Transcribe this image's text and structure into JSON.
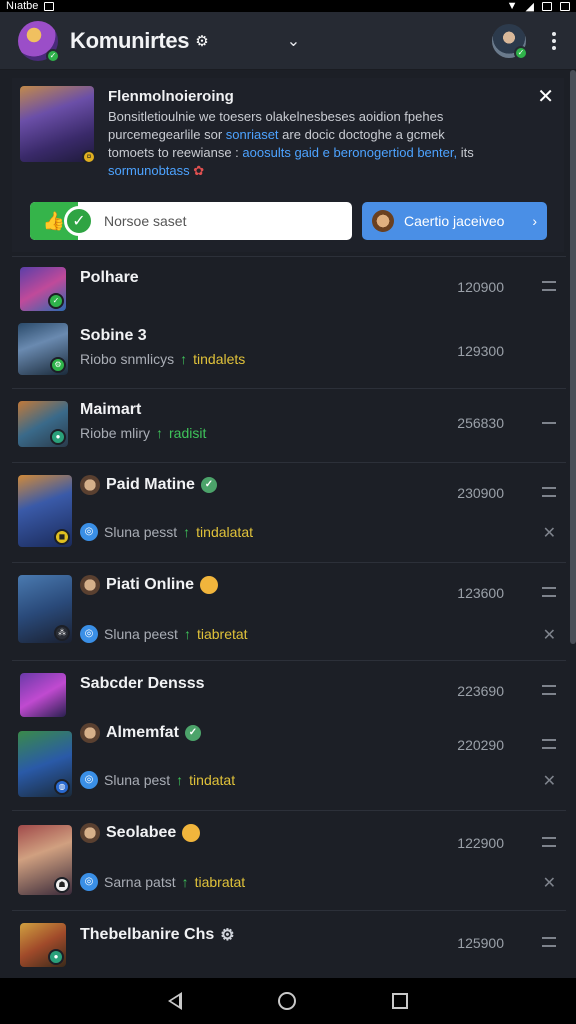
{
  "status_bar": {
    "carrier": "Nıatbe"
  },
  "header": {
    "title": "Komunirtes",
    "title_icon": "settings-icon",
    "user_avatar": "user-avatar"
  },
  "banner": {
    "title": "Flenmolnoieroing",
    "text_1": "Bonsitletioulnie we toesers olakelnesbeses aoidion fpehes",
    "text_2": "purcemegearlile sor",
    "text_2_link": "sonriaset",
    "text_3": "are docic doctoghe a gcmek",
    "text_4": "tomoets to reewianse :",
    "text_4_link": "aoosults gaid e beronogertiod benter,",
    "text_4_end": "its",
    "text_5_link": "sormunobtass",
    "vote_label": "Norsoe saset",
    "cta_label": "Caertio jaceiveo",
    "colors": {
      "vote": "#35b44a",
      "cta": "#4a8fe6"
    }
  },
  "list": [
    {
      "title": "Polhare",
      "subtitle": "",
      "tag": "",
      "count": "120900"
    },
    {
      "title": "Sobine 3",
      "subtitle": "Riobo snmlicys",
      "tag": "tindalets",
      "count": "129300"
    },
    {
      "title": "Maimart",
      "subtitle": "Riobe mliry",
      "tag": "radisit",
      "count": "256830"
    },
    {
      "title": "Paid Matine",
      "subtitle": "Sluna pesst",
      "tag": "tindalatat",
      "count": "230900"
    },
    {
      "title": "Piati Online",
      "subtitle": "Sluna peest",
      "tag": "tiabretat",
      "count": "123600"
    },
    {
      "title": "Sabcder Densss",
      "subtitle": "",
      "tag": "",
      "count": "223690"
    },
    {
      "title": "Almemfat",
      "subtitle": "Sluna pest",
      "tag": "tindatat",
      "count": "220290"
    },
    {
      "title": "Seolabee",
      "subtitle": "Sarna patst",
      "tag": "tiabratat",
      "count": "122900"
    },
    {
      "title": "Thebelbanire Chs",
      "subtitle": "",
      "tag": "",
      "count": "125900"
    }
  ]
}
